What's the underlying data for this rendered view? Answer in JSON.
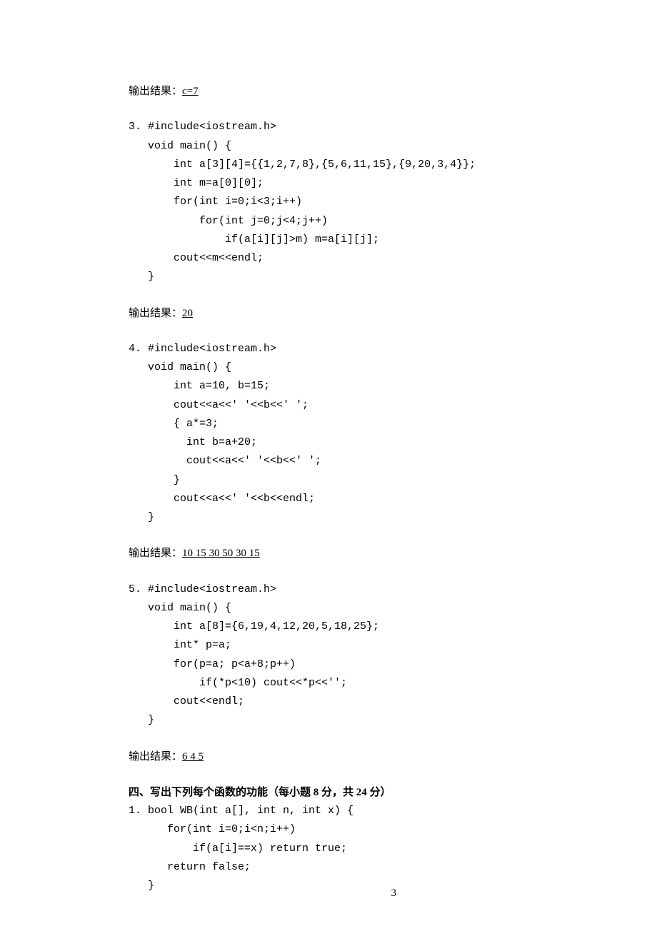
{
  "result2": {
    "label": "输出结果：",
    "value": "c=7"
  },
  "q3": {
    "l1": "3. #include<iostream.h>",
    "l2": "   void main() {",
    "l3": "       int a[3][4]={{1,2,7,8},{5,6,11,15},{9,20,3,4}};",
    "l4": "       int m=a[0][0];",
    "l5": "       for(int i=0;i<3;i++)",
    "l6": "           for(int j=0;j<4;j++)",
    "l7": "               if(a[i][j]>m) m=a[i][j];",
    "l8": "       cout<<m<<endl;",
    "l9": "   }"
  },
  "result3": {
    "label": "输出结果：",
    "value": "20"
  },
  "q4": {
    "l1": "4. #include<iostream.h>",
    "l2": "   void main() {",
    "l3": "       int a=10, b=15;",
    "l4": "       cout<<a<<' '<<b<<' ';",
    "l5": "       { a*=3;",
    "l6": "         int b=a+20;",
    "l7": "         cout<<a<<' '<<b<<' ';",
    "l8": "       }",
    "l9": "       cout<<a<<' '<<b<<endl;",
    "l10": "   }"
  },
  "result4": {
    "label": "输出结果：",
    "value": "10 15 30 50 30 15"
  },
  "q5": {
    "l1": "5. #include<iostream.h>",
    "l2": "   void main() {",
    "l3": "       int a[8]={6,19,4,12,20,5,18,25};",
    "l4": "       int* p=a;",
    "l5": "       for(p=a; p<a+8;p++)",
    "l6": "           if(*p<10) cout<<*p<<'';",
    "l7": "       cout<<endl;",
    "l8": "   }"
  },
  "result5": {
    "label": "输出结果：",
    "value": "6 4 5"
  },
  "section4": {
    "title": "四、写出下列每个函数的功能（每小题 8 分，共 24 分）"
  },
  "q41": {
    "l1": "1. bool WB(int a[], int n, int x) {",
    "l2": "      for(int i=0;i<n;i++)",
    "l3": "          if(a[i]==x) return true;",
    "l4": "      return false;",
    "l5": "   }"
  },
  "pagenum": "3"
}
